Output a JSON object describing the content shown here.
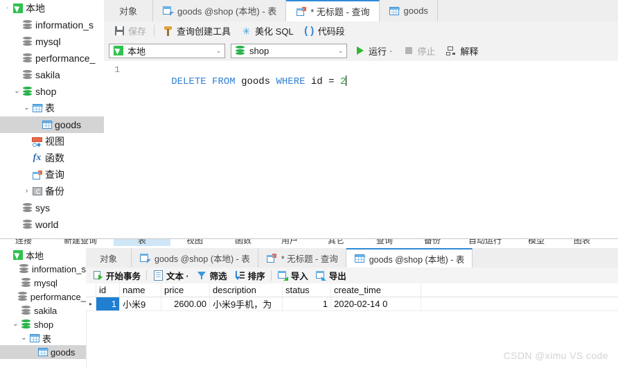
{
  "top_window": {
    "tree": [
      {
        "label": "本地",
        "icon": "local-connection-icon",
        "indent": 0,
        "twisty": "·",
        "selected": false
      },
      {
        "label": "information_s",
        "icon": "database-icon",
        "indent": 1,
        "twisty": "",
        "selected": false
      },
      {
        "label": "mysql",
        "icon": "database-icon",
        "indent": 1,
        "twisty": "",
        "selected": false
      },
      {
        "label": "performance_",
        "icon": "database-icon",
        "indent": 1,
        "twisty": "",
        "selected": false
      },
      {
        "label": "sakila",
        "icon": "database-icon",
        "indent": 1,
        "twisty": "",
        "selected": false
      },
      {
        "label": "shop",
        "icon": "database-open-icon",
        "indent": 1,
        "twisty": "⌄",
        "selected": false
      },
      {
        "label": "表",
        "icon": "table-folder-icon",
        "indent": 2,
        "twisty": "⌄",
        "selected": false
      },
      {
        "label": "goods",
        "icon": "table-icon",
        "indent": 3,
        "twisty": "",
        "selected": true
      },
      {
        "label": "视图",
        "icon": "view-icon",
        "indent": 2,
        "twisty": "",
        "selected": false
      },
      {
        "label": "函数",
        "icon": "function-icon",
        "indent": 2,
        "twisty": "",
        "selected": false
      },
      {
        "label": "查询",
        "icon": "query-icon",
        "indent": 2,
        "twisty": "",
        "selected": false
      },
      {
        "label": "备份",
        "icon": "backup-icon",
        "indent": 2,
        "twisty": "›",
        "selected": false
      },
      {
        "label": "sys",
        "icon": "database-icon",
        "indent": 1,
        "twisty": "",
        "selected": false
      },
      {
        "label": "world",
        "icon": "database-icon",
        "indent": 1,
        "twisty": "",
        "selected": false
      }
    ],
    "tabs": [
      {
        "label": "对象",
        "icon": "",
        "active": false
      },
      {
        "label": "goods @shop (本地) - 表",
        "icon": "table-edit-icon",
        "active": false
      },
      {
        "label": "* 无标题 - 查询",
        "icon": "query-icon",
        "active": true
      },
      {
        "label": "goods",
        "icon": "table-icon",
        "active": false
      }
    ],
    "toolbar": {
      "save_label": "保存",
      "query_builder_label": "查询创建工具",
      "beautify_label": "美化 SQL",
      "snippet_label": "代码段"
    },
    "connection_row": {
      "connection_value": "本地",
      "database_value": "shop",
      "run_label": "运行",
      "run_dropdown": "·",
      "stop_label": "停止",
      "explain_label": "解释"
    },
    "editor": {
      "line_number": "1",
      "tokens": [
        {
          "text": "DELETE",
          "type": "keyword"
        },
        {
          "text": " ",
          "type": "plain"
        },
        {
          "text": "FROM",
          "type": "keyword"
        },
        {
          "text": " ",
          "type": "plain"
        },
        {
          "text": "goods",
          "type": "identifier"
        },
        {
          "text": " ",
          "type": "plain"
        },
        {
          "text": "WHERE",
          "type": "keyword"
        },
        {
          "text": " ",
          "type": "plain"
        },
        {
          "text": "id",
          "type": "identifier"
        },
        {
          "text": " = ",
          "type": "plain"
        },
        {
          "text": "2",
          "type": "number"
        }
      ],
      "full_text": "DELETE FROM goods WHERE id = 2"
    }
  },
  "bottom_window": {
    "ribbon": [
      {
        "label": "连接",
        "selected": false
      },
      {
        "label": "新建查询",
        "selected": false
      },
      {
        "label": "表",
        "selected": true
      },
      {
        "label": "视图",
        "selected": false
      },
      {
        "label": "函数",
        "selected": false
      },
      {
        "label": "用户",
        "selected": false
      },
      {
        "label": "其它",
        "selected": false
      },
      {
        "label": "查询",
        "selected": false
      },
      {
        "label": "备份",
        "selected": false
      },
      {
        "label": "自动运行",
        "selected": false
      },
      {
        "label": "模型",
        "selected": false
      },
      {
        "label": "图表",
        "selected": false
      }
    ],
    "tree": [
      {
        "label": "本地",
        "icon": "local-connection-icon",
        "indent": 0,
        "twisty": "",
        "selected": false
      },
      {
        "label": "information_s",
        "icon": "database-icon",
        "indent": 1,
        "twisty": "",
        "selected": false
      },
      {
        "label": "mysql",
        "icon": "database-icon",
        "indent": 1,
        "twisty": "",
        "selected": false
      },
      {
        "label": "performance_",
        "icon": "database-icon",
        "indent": 1,
        "twisty": "",
        "selected": false
      },
      {
        "label": "sakila",
        "icon": "database-icon",
        "indent": 1,
        "twisty": "",
        "selected": false
      },
      {
        "label": "shop",
        "icon": "database-open-icon",
        "indent": 1,
        "twisty": "⌄",
        "selected": false
      },
      {
        "label": "表",
        "icon": "table-folder-icon",
        "indent": 2,
        "twisty": "⌄",
        "selected": false
      },
      {
        "label": "goods",
        "icon": "table-icon",
        "indent": 3,
        "twisty": "",
        "selected": true
      }
    ],
    "tabs": [
      {
        "label": "对象",
        "icon": "",
        "active": false
      },
      {
        "label": "goods @shop (本地) - 表",
        "icon": "table-edit-icon",
        "active": false
      },
      {
        "label": "* 无标题 - 查询",
        "icon": "query-icon",
        "active": false
      },
      {
        "label": "goods @shop (本地) - 表",
        "icon": "table-icon",
        "active": true
      }
    ],
    "grid_toolbar": {
      "begin_transaction_label": "开始事务",
      "text_label": "文本 ·",
      "filter_label": "筛选",
      "sort_label": "排序",
      "import_label": "导入",
      "export_label": "导出"
    },
    "grid": {
      "columns": [
        "id",
        "name",
        "price",
        "description",
        "status",
        "create_time"
      ],
      "rows": [
        {
          "marker": "▸",
          "id": "1",
          "name": "小米9",
          "price": "2600.00",
          "description": "小米9手机，为",
          "status": "1",
          "create_time": "2020-02-14 0"
        }
      ]
    }
  },
  "watermark": "CSDN @ximu VS code",
  "colors": {
    "accent_blue": "#2f8ad6",
    "selection_blue": "#1f7fd1",
    "green": "#2eb82e",
    "keyword_blue": "#2e7fd4",
    "number_green": "#1fa52f",
    "tree_selected": "#d4d4d4"
  }
}
